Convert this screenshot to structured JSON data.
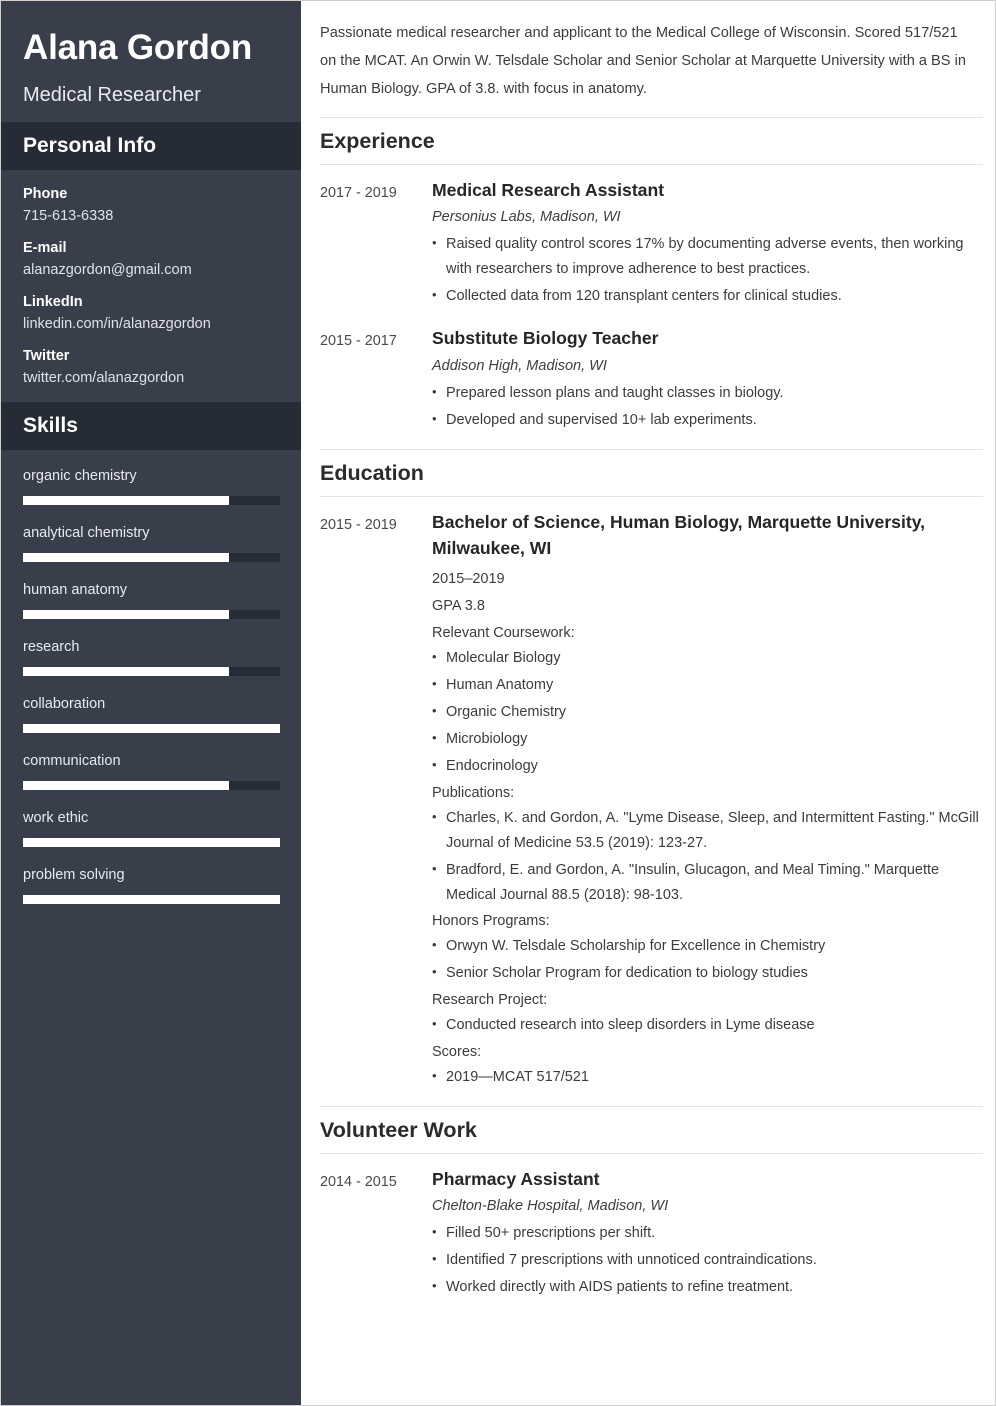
{
  "sidebar": {
    "name": "Alana Gordon",
    "job_title": "Medical Researcher",
    "personal_info_heading": "Personal Info",
    "contacts": [
      {
        "label": "Phone",
        "value": "715-613-6338"
      },
      {
        "label": "E-mail",
        "value": "alanazgordon@gmail.com"
      },
      {
        "label": "LinkedIn",
        "value": "linkedin.com/in/alanazgordon"
      },
      {
        "label": "Twitter",
        "value": "twitter.com/alanazgordon"
      }
    ],
    "skills_heading": "Skills",
    "skills": [
      {
        "name": "organic chemistry",
        "level": 80
      },
      {
        "name": "analytical chemistry",
        "level": 80
      },
      {
        "name": "human anatomy",
        "level": 80
      },
      {
        "name": "research",
        "level": 80
      },
      {
        "name": "collaboration",
        "level": 100
      },
      {
        "name": "communication",
        "level": 80
      },
      {
        "name": "work ethic",
        "level": 100
      },
      {
        "name": "problem solving",
        "level": 100
      }
    ]
  },
  "main": {
    "summary": "Passionate medical researcher and applicant to the Medical College of Wisconsin. Scored 517/521 on the MCAT. An Orwin W. Telsdale Scholar and Senior Scholar at Marquette University with a BS in Human Biology. GPA of 3.8. with focus in anatomy.",
    "experience": {
      "title": "Experience",
      "entries": [
        {
          "dates": "2017 - 2019",
          "role": "Medical Research Assistant",
          "org": "Personius Labs, Madison, WI",
          "bullets": [
            "Raised quality control scores 17% by documenting adverse events, then working with researchers to improve adherence to best practices.",
            "Collected data from 120 transplant centers for clinical studies."
          ]
        },
        {
          "dates": "2015 - 2017",
          "role": "Substitute Biology Teacher",
          "org": "Addison High, Madison, WI",
          "bullets": [
            "Prepared lesson plans and taught classes in biology.",
            "Developed and supervised 10+ lab experiments."
          ]
        }
      ]
    },
    "education": {
      "title": "Education",
      "dates": "2015 - 2019",
      "degree": "Bachelor of Science, Human Biology, Marquette University, Milwaukee, WI",
      "years": "2015–2019",
      "gpa": "GPA 3.8",
      "coursework_label": "Relevant Coursework:",
      "coursework": [
        "Molecular Biology",
        "Human Anatomy",
        "Organic Chemistry",
        "Microbiology",
        "Endocrinology"
      ],
      "publications_label": "Publications:",
      "publications": [
        "Charles, K. and Gordon, A. \"Lyme Disease, Sleep, and Intermittent Fasting.\" McGill Journal of Medicine 53.5 (2019): 123-27.",
        "Bradford, E. and Gordon, A. \"Insulin, Glucagon, and Meal Timing.\" Marquette Medical Journal 88.5 (2018): 98-103."
      ],
      "honors_label": "Honors Programs:",
      "honors": [
        "Orwyn W. Telsdale Scholarship for Excellence in Chemistry",
        "Senior Scholar Program for dedication to biology studies"
      ],
      "research_label": "Research Project:",
      "research": [
        "Conducted research into sleep disorders in Lyme disease"
      ],
      "scores_label": "Scores:",
      "scores": [
        "2019—MCAT 517/521"
      ]
    },
    "volunteer": {
      "title": "Volunteer Work",
      "entries": [
        {
          "dates": "2014 - 2015",
          "role": "Pharmacy Assistant",
          "org": "Chelton-Blake Hospital, Madison, WI",
          "bullets": [
            "Filled 50+ prescriptions per shift.",
            "Identified 7 prescriptions with unnoticed contraindications.",
            "Worked directly with AIDS patients to refine treatment."
          ]
        }
      ]
    }
  },
  "theme": {
    "sidebar_bg": "#383f4b",
    "sidebar_header_bg": "#262c36",
    "skill_fill": "#ffffff",
    "skill_track": "#272d38",
    "text_dark": "#3c3c3c"
  }
}
